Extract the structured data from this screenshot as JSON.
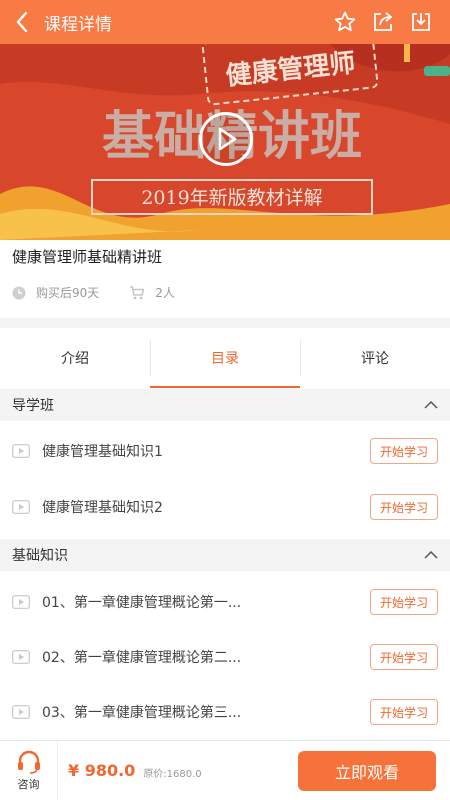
{
  "header": {
    "title": "课程详情",
    "icons": [
      "back-icon",
      "star-icon",
      "share-icon",
      "download-icon"
    ]
  },
  "banner": {
    "badge_text": "健康管理师",
    "main_text": "基础精讲班",
    "sub_text": "2019年新版教材详解"
  },
  "course": {
    "title": "健康管理师基础精讲班",
    "validity": "购买后90天",
    "buyers": "2人"
  },
  "tabs": [
    {
      "label": "介绍"
    },
    {
      "label": "目录"
    },
    {
      "label": "评论"
    }
  ],
  "sections": [
    {
      "title": "导学班",
      "lessons": [
        {
          "name": "健康管理基础知识1",
          "action": "开始学习"
        },
        {
          "name": "健康管理基础知识2",
          "action": "开始学习"
        }
      ]
    },
    {
      "title": "基础知识",
      "lessons": [
        {
          "name": "01、第一章健康管理概论第一...",
          "action": "开始学习"
        },
        {
          "name": "02、第一章健康管理概论第二...",
          "action": "开始学习"
        },
        {
          "name": "03、第一章健康管理概论第三...",
          "action": "开始学习"
        }
      ]
    }
  ],
  "bottom": {
    "consult_label": "咨询",
    "price": "¥ 980.0",
    "original_price": "原价:1680.0",
    "watch_button": "立即观看"
  },
  "colors": {
    "accent": "#f87a45",
    "button": "#f5733a",
    "text_accent": "#f2672e"
  }
}
